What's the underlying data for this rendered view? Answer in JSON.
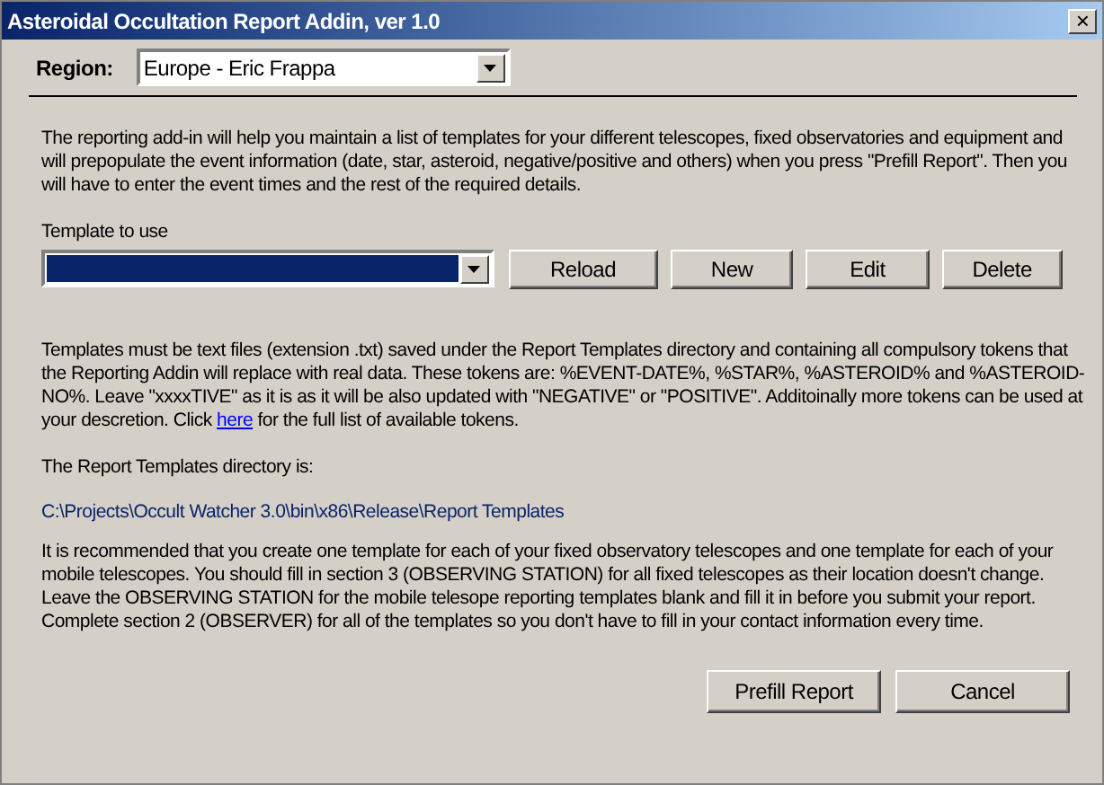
{
  "window": {
    "title": "Asteroidal Occultation Report Addin, ver 1.0",
    "close": "×"
  },
  "region": {
    "label": "Region:",
    "value": "Europe - Eric Frappa"
  },
  "intro": "The reporting add-in will help you maintain a list of templates for your different telescopes, fixed observatories and equipment and will prepopulate the event information (date, star, asteroid, negative/positive and others) when you press \"Prefill Report\". Then you will have to enter the event times and the rest of the required  details.",
  "template": {
    "label": "Template to use",
    "highlighted": true
  },
  "template_buttons": [
    "Reload",
    "New",
    "Edit",
    "Delete"
  ],
  "tokens_text": {
    "before": "Templates must be text files (extension .txt) saved under the Report Templates directory and containing all compulsory tokens that the Reporting Addin will replace with real data. These tokens are: %EVENT-DATE%, %STAR%, %ASTEROID% and %ASTEROID-NO%. Leave \"xxxxTIVE\" as it is as it will be also updated with \"NEGATIVE\" or \"POSITIVE\". Additoinally more tokens can be used at your descretion. Click ",
    "link": "here",
    "after": " for the full list of available tokens."
  },
  "directory": {
    "label": "The Report Templates directory is:",
    "path": "C:\\Projects\\Occult Watcher 3.0\\bin\\x86\\Release\\Report Templates"
  },
  "recommendation": "It is recommended that you create one template for each of your fixed observatory telescopes and one template for each of your mobile telescopes. You should fill in section 3 (OBSERVING STATION) for all fixed telescopes as their location doesn't change. Leave the OBSERVING STATION for the mobile telesope reporting templates blank and fill it in before you submit your report. Complete section 2 (OBSERVER) for all of the templates so you don't have to fill in your contact information every time.",
  "buttons": [
    "Prefill Report",
    "Cancel"
  ]
}
